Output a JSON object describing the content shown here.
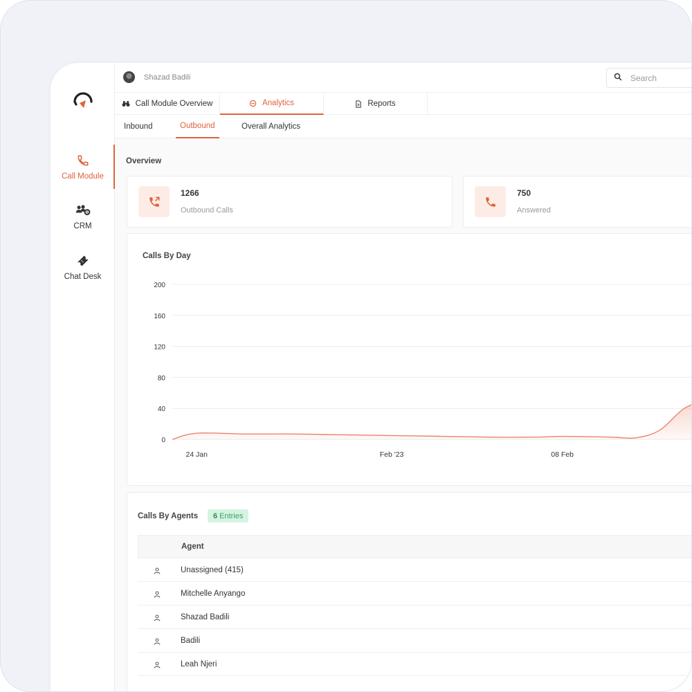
{
  "header": {
    "user_name": "Shazad Badili",
    "search_placeholder": "Search"
  },
  "sidebar": {
    "items": [
      {
        "label": "Call Module",
        "icon": "phone-icon",
        "active": true
      },
      {
        "label": "CRM",
        "icon": "people-gear-icon",
        "active": false
      },
      {
        "label": "Chat Desk",
        "icon": "ticket-icon",
        "active": false
      }
    ]
  },
  "tabs": [
    {
      "label": "Call Module Overview",
      "icon": "binoculars-icon"
    },
    {
      "label": "Analytics",
      "icon": "analytics-icon",
      "active": true
    },
    {
      "label": "Reports",
      "icon": "document-icon"
    }
  ],
  "subtabs": [
    {
      "label": "Inbound"
    },
    {
      "label": "Outbound",
      "active": true
    },
    {
      "label": "Overall Analytics"
    }
  ],
  "overview": {
    "title": "Overview",
    "cards": [
      {
        "value": "1266",
        "label": "Outbound Calls",
        "icon": "phone-outgoing-icon"
      },
      {
        "value": "750",
        "label": "Answered",
        "icon": "phone-icon"
      }
    ]
  },
  "chart_data": {
    "type": "area",
    "title": "Calls By Day",
    "yticks": [
      "200",
      "160",
      "120",
      "80",
      "40",
      "0"
    ],
    "ylim": [
      0,
      200
    ],
    "xtick_labels": [
      "24 Jan",
      "Feb '23",
      "08 Feb"
    ],
    "x": [
      "2023-01-23",
      "2023-01-24",
      "2023-01-26",
      "2023-01-28",
      "2023-01-30",
      "2023-02-01",
      "2023-02-03",
      "2023-02-05",
      "2023-02-07",
      "2023-02-08",
      "2023-02-10",
      "2023-02-11",
      "2023-02-12",
      "2023-02-13",
      "2023-02-14"
    ],
    "series": [
      {
        "values": [
          0,
          8,
          7,
          7,
          6,
          5,
          4,
          3,
          3,
          4,
          3,
          2,
          12,
          40,
          52
        ]
      }
    ],
    "color": "#e9846a",
    "grid": true
  },
  "agents": {
    "title": "Calls By Agents",
    "entries_count": "6",
    "entries_label": "Entries",
    "column_header": "Agent",
    "rows": [
      {
        "name": "Unassigned (415)"
      },
      {
        "name": "Mitchelle Anyango"
      },
      {
        "name": "Shazad Badili"
      },
      {
        "name": "Badili"
      },
      {
        "name": "Leah Njeri"
      }
    ]
  },
  "colors": {
    "accent": "#e0613a",
    "badge_bg": "#d6f3e2",
    "badge_text": "#37a36a"
  }
}
